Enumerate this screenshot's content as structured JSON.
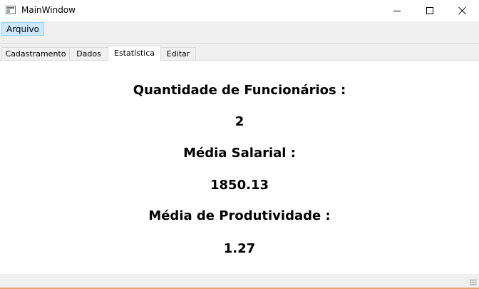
{
  "window": {
    "title": "MainWindow"
  },
  "menu": {
    "items": [
      {
        "label": "Arquivo"
      }
    ]
  },
  "tabs": [
    {
      "label": "Cadastramento",
      "active": false
    },
    {
      "label": "Dados",
      "active": false
    },
    {
      "label": "Estatística",
      "active": true
    },
    {
      "label": "Editar",
      "active": false
    }
  ],
  "stats": {
    "employee_count_label": "Quantidade de Funcionários :",
    "employee_count_value": "2",
    "avg_salary_label": "Média Salarial :",
    "avg_salary_value": "1850.13",
    "avg_productivity_label": "Média de Produtividade :",
    "avg_productivity_value": "1.27"
  }
}
